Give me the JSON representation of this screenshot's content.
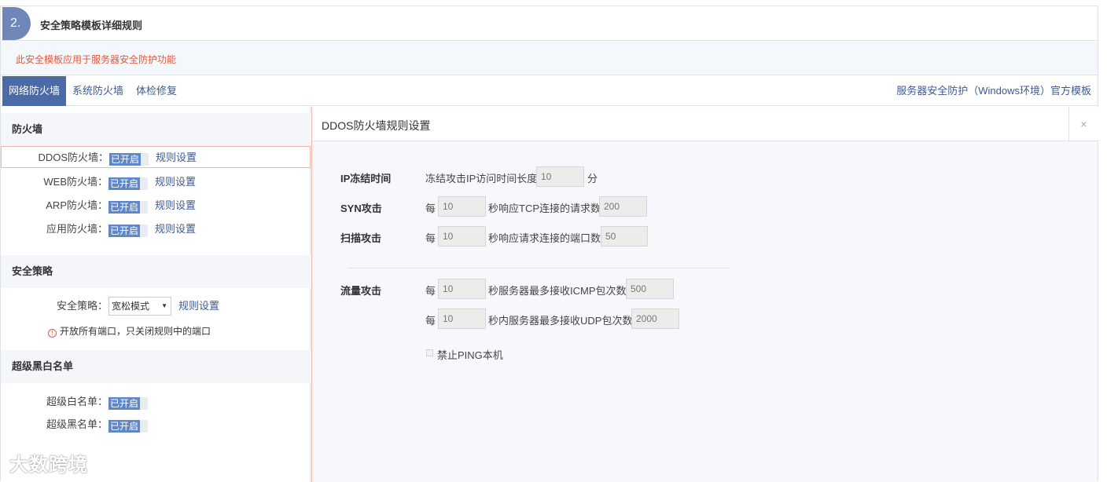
{
  "header": {
    "step": "2.",
    "title": "安全策略模板详细规则"
  },
  "notice": "此安全模板应用于服务器安全防护功能",
  "tabs": [
    "网络防火墙",
    "系统防火墙",
    "体检修复"
  ],
  "template_name": "服务器安全防护（Windows环境）官方模板",
  "left": {
    "firewall_section": "防火墙",
    "firewalls": [
      {
        "label": "DDOS防火墙：",
        "status": "已开启",
        "link": "规则设置"
      },
      {
        "label": "WEB防火墙：",
        "status": "已开启",
        "link": "规则设置"
      },
      {
        "label": "ARP防火墙：",
        "status": "已开启",
        "link": "规则设置"
      },
      {
        "label": "应用防火墙：",
        "status": "已开启",
        "link": "规则设置"
      }
    ],
    "policy_section": "安全策略",
    "policy_label": "安全策略：",
    "policy_value": "宽松模式",
    "policy_link": "规则设置",
    "policy_warning": "开放所有端口，只关闭规则中的端口",
    "blackwhite_section": "超级黑白名单",
    "whitelist_label": "超级白名单：",
    "whitelist_status": "已开启",
    "blacklist_label": "超级黑名单：",
    "blacklist_status": "已开启"
  },
  "panel": {
    "title": "DDOS防火墙规则设置",
    "close": "×",
    "ip_freeze": {
      "label": "IP冻结时间",
      "text": "冻结攻击IP访问时间长度",
      "value": "10",
      "unit": "分"
    },
    "syn": {
      "label": "SYN攻击",
      "per": "每",
      "seconds": "10",
      "text": "秒响应TCP连接的请求数",
      "value": "200"
    },
    "scan": {
      "label": "扫描攻击",
      "per": "每",
      "seconds": "10",
      "text": "秒响应请求连接的端口数",
      "value": "50"
    },
    "flow": {
      "label": "流量攻击",
      "per": "每",
      "seconds": "10",
      "text": "秒服务器最多接收ICMP包次数",
      "value": "500"
    },
    "udp": {
      "per": "每",
      "seconds": "10",
      "text": "秒内服务器最多接收UDP包次数",
      "value": "2000"
    },
    "ping": {
      "label": "禁止PING本机",
      "checked": false
    }
  },
  "watermark": "大数跨境"
}
